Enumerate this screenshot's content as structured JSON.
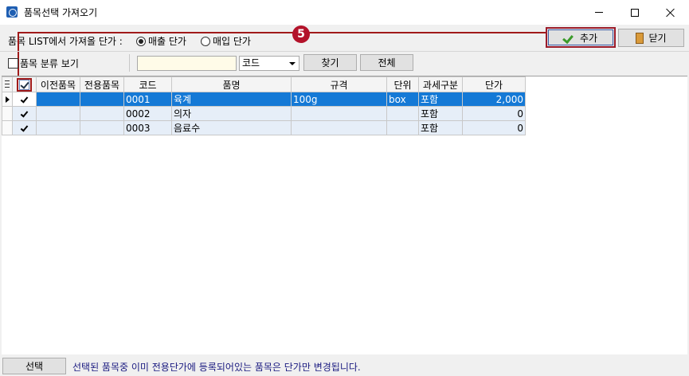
{
  "window": {
    "title": "품목선택 가져오기"
  },
  "toolbar": {
    "price_label": "품목 LIST에서 가져올 단가 :",
    "radio_sell": "매출 단가",
    "radio_buy": "매입 단가",
    "add_label": "추가",
    "close_label": "닫기"
  },
  "callout": {
    "number": "5"
  },
  "filter": {
    "category_view_label": "품목 분류 보기",
    "search_value": "",
    "select_value": "코드",
    "find_label": "찾기",
    "all_label": "전체"
  },
  "grid": {
    "columns": [
      "이전품목",
      "전용품목",
      "코드",
      "품명",
      "규격",
      "단위",
      "과세구분",
      "단가"
    ],
    "rows": [
      {
        "prev": "",
        "exclusive": "",
        "code": "0001",
        "name": "육계",
        "spec": "100g",
        "unit": "box",
        "tax": "포함",
        "price": "2,000"
      },
      {
        "prev": "",
        "exclusive": "",
        "code": "0002",
        "name": "의자",
        "spec": "",
        "unit": "",
        "tax": "포함",
        "price": "0"
      },
      {
        "prev": "",
        "exclusive": "",
        "code": "0003",
        "name": "음료수",
        "spec": "",
        "unit": "",
        "tax": "포함",
        "price": "0"
      }
    ]
  },
  "footer": {
    "select_label": "선택",
    "message": "선택된 품목중 이미 전용단가에 등록되어있는 품목은 단가만 변경됩니다."
  }
}
